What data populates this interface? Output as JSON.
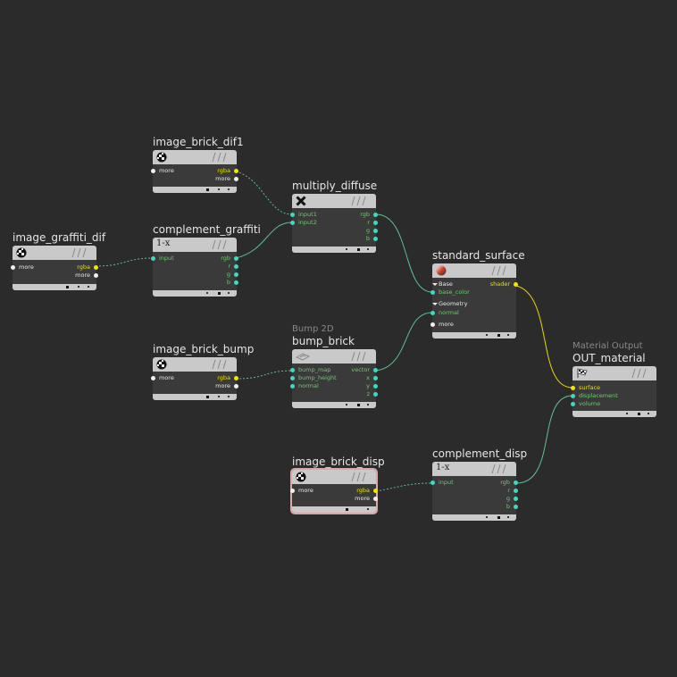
{
  "graph": {
    "nodes": {
      "image_graffiti_dif": {
        "title": "image_graffiti_dif",
        "icon": "checker-ball-icon",
        "inputs": [
          "more"
        ],
        "outputs": [
          "rgba",
          "more"
        ]
      },
      "image_brick_dif1": {
        "title": "image_brick_dif1",
        "icon": "checker-ball-icon",
        "inputs": [
          "more"
        ],
        "outputs": [
          "rgba",
          "more"
        ]
      },
      "complement_graffiti": {
        "title": "complement_graffiti",
        "icon": "one-minus-x-icon",
        "inputs": [
          "input"
        ],
        "outputs": [
          "rgb",
          "r",
          "g",
          "b"
        ]
      },
      "multiply_diffuse": {
        "title": "multiply_diffuse",
        "icon": "multiply-x-icon",
        "inputs": [
          "input1",
          "input2"
        ],
        "outputs": [
          "rgb",
          "r",
          "g",
          "b"
        ]
      },
      "standard_surface": {
        "title": "standard_surface",
        "icon": "shader-ball-icon",
        "sections": [
          "Base",
          "Geometry"
        ],
        "inputs": [
          "base_color",
          "normal",
          "more"
        ],
        "outputs": [
          "shader"
        ]
      },
      "image_brick_bump": {
        "title": "image_brick_bump",
        "icon": "checker-ball-icon",
        "inputs": [
          "more"
        ],
        "outputs": [
          "rgba",
          "more"
        ]
      },
      "bump_brick": {
        "type_label": "Bump 2D",
        "title": "bump_brick",
        "icon": "bump-plane-icon",
        "inputs": [
          "bump_map",
          "bump_height",
          "normal"
        ],
        "outputs": [
          "vector",
          "x",
          "y",
          "z"
        ]
      },
      "OUT_material": {
        "type_label": "Material Output",
        "title": "OUT_material",
        "icon": "checkered-flag-icon",
        "inputs": [
          "surface",
          "displacement",
          "volume"
        ]
      },
      "image_brick_disp": {
        "title": "image_brick_disp",
        "icon": "checker-ball-icon",
        "inputs": [
          "more"
        ],
        "outputs": [
          "rgba",
          "more"
        ],
        "selected": true
      },
      "complement_disp": {
        "title": "complement_disp",
        "icon": "one-minus-x-icon",
        "inputs": [
          "input"
        ],
        "outputs": [
          "rgb",
          "r",
          "g",
          "b"
        ]
      }
    },
    "one_minus_x_glyph": "1-x",
    "colors": {
      "background": "#2b2b2b",
      "node_header": "#c9c9c9",
      "node_body": "#3a3a3a",
      "port_yellow": "#f0e800",
      "port_cyan": "#40d8c0",
      "wire_green": "#5cc090",
      "wire_yellow": "#e8d800",
      "selection": "#d8a8a8"
    }
  }
}
